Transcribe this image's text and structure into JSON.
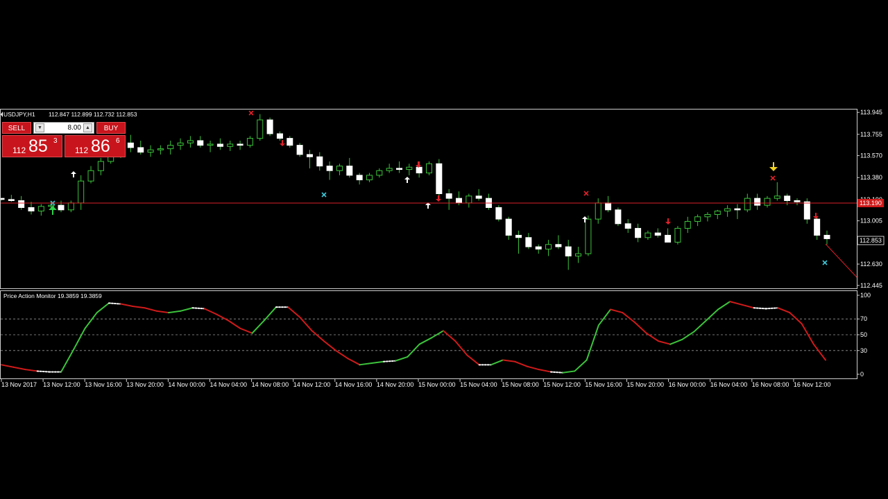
{
  "header": {
    "title": "USDJPY,H1",
    "ohlc": "112.847 112.899 112.732 112.853"
  },
  "trade_panel": {
    "sell_label": "SELL",
    "buy_label": "BUY",
    "lot_value": "8.00",
    "sell_price_small": "112",
    "sell_price_big": "85",
    "sell_price_sup": "3",
    "buy_price_small": "112",
    "buy_price_big": "86",
    "buy_price_sup": "6",
    "button_color": "#c8141c"
  },
  "price_axis": {
    "ticks": [
      113.945,
      113.755,
      113.57,
      113.38,
      113.19,
      113.005,
      112.82,
      112.63,
      112.445
    ],
    "tick_labels": [
      "113.945",
      "113.755",
      "113.570",
      "113.380",
      "113.190",
      "113.005",
      "112.820",
      "112.630",
      "112.445"
    ],
    "current_price_label": "112.853",
    "red_line_label": "113.190"
  },
  "indicator": {
    "title": "Price Action Monitor 19.3859 19.3859",
    "levels": [
      100,
      70,
      50,
      30,
      0
    ],
    "level_labels": [
      "100",
      "70",
      "50",
      "30",
      "0"
    ]
  },
  "time_axis": {
    "labels": [
      "13 Nov 2017",
      "13 Nov 12:00",
      "13 Nov 16:00",
      "13 Nov 20:00",
      "14 Nov 00:00",
      "14 Nov 04:00",
      "14 Nov 08:00",
      "14 Nov 12:00",
      "14 Nov 16:00",
      "14 Nov 20:00",
      "15 Nov 00:00",
      "15 Nov 04:00",
      "15 Nov 08:00",
      "15 Nov 12:00",
      "15 Nov 16:00",
      "15 Nov 20:00",
      "16 Nov 00:00",
      "16 Nov 04:00",
      "16 Nov 08:00",
      "16 Nov 12:00"
    ]
  },
  "colors": {
    "bull_outline": "#3cc43c",
    "bear_fill": "#ffffff",
    "band_outer": "#4a0008",
    "band_inner": "#10124a",
    "band_line_red": "#e0202a",
    "band_line_blue": "#7fb8ff",
    "osc_green": "#3cc43c",
    "osc_red": "#d01a1a"
  },
  "chart_data": [
    {
      "type": "candlestick",
      "title": "USDJPY,H1",
      "ylim": [
        112.42,
        113.97
      ],
      "candles": [
        [
          113.2,
          113.2,
          113.18,
          113.19
        ],
        [
          113.19,
          113.23,
          113.17,
          113.18
        ],
        [
          113.18,
          113.22,
          113.1,
          113.12
        ],
        [
          113.12,
          113.17,
          113.06,
          113.09
        ],
        [
          113.09,
          113.15,
          113.05,
          113.13
        ],
        [
          113.13,
          113.17,
          113.1,
          113.14
        ],
        [
          113.14,
          113.18,
          113.08,
          113.1
        ],
        [
          113.1,
          113.18,
          113.08,
          113.16
        ],
        [
          113.16,
          113.4,
          113.1,
          113.35
        ],
        [
          113.35,
          113.48,
          113.33,
          113.44
        ],
        [
          113.44,
          113.55,
          113.4,
          113.52
        ],
        [
          113.52,
          113.65,
          113.5,
          113.6
        ],
        [
          113.6,
          113.72,
          113.55,
          113.68
        ],
        [
          113.68,
          113.75,
          113.6,
          113.64
        ],
        [
          113.64,
          113.7,
          113.58,
          113.6
        ],
        [
          113.6,
          113.66,
          113.56,
          113.62
        ],
        [
          113.62,
          113.66,
          113.58,
          113.63
        ],
        [
          113.63,
          113.7,
          113.58,
          113.66
        ],
        [
          113.66,
          113.72,
          113.62,
          113.68
        ],
        [
          113.68,
          113.74,
          113.64,
          113.7
        ],
        [
          113.7,
          113.74,
          113.64,
          113.66
        ],
        [
          113.66,
          113.7,
          113.6,
          113.67
        ],
        [
          113.67,
          113.72,
          113.62,
          113.65
        ],
        [
          113.65,
          113.7,
          113.61,
          113.67
        ],
        [
          113.67,
          113.7,
          113.62,
          113.66
        ],
        [
          113.66,
          113.74,
          113.64,
          113.72
        ],
        [
          113.72,
          113.93,
          113.7,
          113.88
        ],
        [
          113.88,
          113.9,
          113.74,
          113.76
        ],
        [
          113.76,
          113.78,
          113.7,
          113.72
        ],
        [
          113.72,
          113.74,
          113.64,
          113.66
        ],
        [
          113.66,
          113.68,
          113.56,
          113.58
        ],
        [
          113.58,
          113.62,
          113.46,
          113.56
        ],
        [
          113.56,
          113.6,
          113.44,
          113.48
        ],
        [
          113.48,
          113.52,
          113.36,
          113.44
        ],
        [
          113.44,
          113.5,
          113.4,
          113.48
        ],
        [
          113.48,
          113.55,
          113.38,
          113.4
        ],
        [
          113.4,
          113.42,
          113.32,
          113.36
        ],
        [
          113.36,
          113.42,
          113.34,
          113.4
        ],
        [
          113.4,
          113.46,
          113.38,
          113.44
        ],
        [
          113.44,
          113.5,
          113.42,
          113.46
        ],
        [
          113.46,
          113.52,
          113.42,
          113.45
        ],
        [
          113.45,
          113.5,
          113.4,
          113.47
        ],
        [
          113.47,
          113.52,
          113.38,
          113.42
        ],
        [
          113.42,
          113.52,
          113.4,
          113.5
        ],
        [
          113.5,
          113.54,
          113.18,
          113.24
        ],
        [
          113.24,
          113.28,
          113.1,
          113.2
        ],
        [
          113.2,
          113.26,
          113.14,
          113.16
        ],
        [
          113.16,
          113.24,
          113.12,
          113.22
        ],
        [
          113.22,
          113.28,
          113.18,
          113.2
        ],
        [
          113.2,
          113.24,
          113.1,
          113.12
        ],
        [
          113.12,
          113.14,
          113.0,
          113.02
        ],
        [
          113.02,
          113.04,
          112.84,
          112.88
        ],
        [
          112.88,
          112.92,
          112.72,
          112.86
        ],
        [
          112.86,
          112.9,
          112.76,
          112.78
        ],
        [
          112.78,
          112.8,
          112.72,
          112.76
        ],
        [
          112.76,
          112.84,
          112.7,
          112.8
        ],
        [
          112.8,
          112.88,
          112.76,
          112.78
        ],
        [
          112.78,
          112.84,
          112.58,
          112.7
        ],
        [
          112.7,
          112.78,
          112.64,
          112.72
        ],
        [
          112.72,
          113.05,
          112.7,
          113.02
        ],
        [
          113.02,
          113.2,
          112.98,
          113.16
        ],
        [
          113.16,
          113.22,
          113.08,
          113.1
        ],
        [
          113.1,
          113.12,
          112.96,
          112.98
        ],
        [
          112.98,
          113.02,
          112.9,
          112.94
        ],
        [
          112.94,
          112.98,
          112.82,
          112.86
        ],
        [
          112.86,
          112.92,
          112.84,
          112.9
        ],
        [
          112.9,
          112.94,
          112.86,
          112.88
        ],
        [
          112.88,
          112.94,
          112.84,
          112.82
        ],
        [
          112.82,
          112.96,
          112.8,
          112.94
        ],
        [
          112.94,
          113.04,
          112.9,
          113.0
        ],
        [
          113.0,
          113.06,
          112.96,
          113.04
        ],
        [
          113.04,
          113.08,
          113.0,
          113.06
        ],
        [
          113.06,
          113.1,
          113.02,
          113.09
        ],
        [
          113.09,
          113.14,
          113.04,
          113.11
        ],
        [
          113.11,
          113.15,
          113.02,
          113.1
        ],
        [
          113.1,
          113.24,
          113.08,
          113.2
        ],
        [
          113.2,
          113.24,
          113.1,
          113.14
        ],
        [
          113.14,
          113.22,
          113.12,
          113.2
        ],
        [
          113.2,
          113.34,
          113.18,
          113.22
        ],
        [
          113.22,
          113.24,
          113.14,
          113.18
        ],
        [
          113.18,
          113.2,
          113.14,
          113.17
        ],
        [
          113.17,
          113.2,
          112.98,
          113.02
        ],
        [
          113.02,
          113.04,
          112.84,
          112.88
        ],
        [
          112.88,
          112.92,
          112.8,
          112.85
        ]
      ]
    },
    {
      "type": "line",
      "title": "Price Action Monitor 19.3859 19.3859",
      "ylim": [
        0,
        100
      ],
      "values": [
        12,
        9,
        6,
        4,
        3,
        3,
        30,
        58,
        78,
        90,
        89,
        86,
        84,
        80,
        78,
        80,
        84,
        83,
        76,
        68,
        58,
        52,
        68,
        85,
        85,
        72,
        55,
        42,
        30,
        20,
        12,
        14,
        16,
        17,
        22,
        38,
        46,
        55,
        42,
        24,
        12,
        12,
        18,
        16,
        10,
        6,
        3,
        2,
        4,
        18,
        62,
        82,
        78,
        66,
        52,
        42,
        38,
        44,
        54,
        68,
        82,
        92,
        88,
        84,
        83,
        84,
        78,
        64,
        38,
        18
      ]
    }
  ]
}
